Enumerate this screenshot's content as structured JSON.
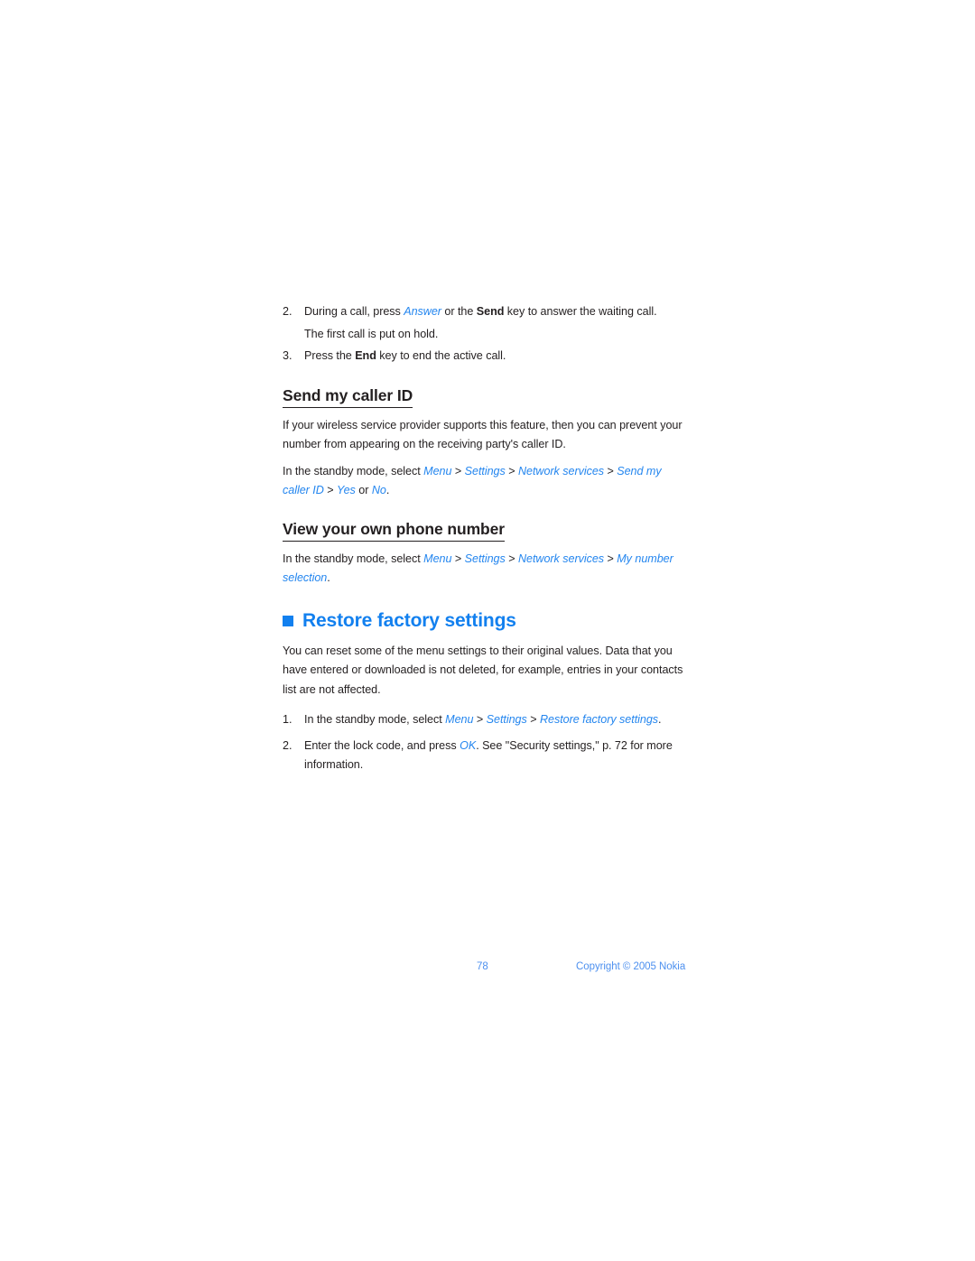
{
  "document": {
    "type": "user-guide-page",
    "page_number": "78",
    "copyright": "Copyright © 2005 Nokia",
    "background_color": "#ffffff",
    "body_text_color": "#231f20",
    "accent_blue": "#1280ef",
    "link_blue": "#2486ef",
    "footer_blue": "#4d90ef"
  },
  "continued_list": {
    "items": [
      {
        "num": "2.",
        "line1_pre": "During a call, press ",
        "line1_italic": "Answer",
        "line1_mid": " or the ",
        "line1_bold": "Send",
        "line1_post": " key to answer the waiting call.",
        "line2": "The first call is put on hold."
      },
      {
        "num": "3.",
        "pre": "Press the ",
        "bold": "End",
        "post": " key to end the active call."
      }
    ]
  },
  "sections": {
    "send_caller_id": {
      "heading": "Send my caller ID",
      "paragraph": "If your wireless service provider supports this feature, then you can prevent your number from appearing on the receiving party's caller ID.",
      "path_intro": "In the standby mode, select ",
      "path": [
        "Menu",
        "Settings",
        "Network services",
        "Send my caller ID",
        "Yes"
      ],
      "path_or": " or ",
      "path_last": "No",
      "path_end": "."
    },
    "view_own_number": {
      "heading": "View your own phone number",
      "path_intro": "In the standby mode, select ",
      "path": [
        "Menu",
        "Settings",
        "Network services",
        "My number selection"
      ],
      "path_end": "."
    },
    "restore_factory": {
      "heading": "Restore factory settings",
      "bullet_icon": "blue-square-bullet",
      "paragraph": "You can reset some of the menu settings to their original values. Data that you have entered or downloaded is not deleted, for example, entries in your contacts list are not affected.",
      "steps": [
        {
          "num": "1.",
          "pre": "In the standby mode, select ",
          "path": [
            "Menu",
            "Settings",
            "Restore factory settings"
          ],
          "post": "."
        },
        {
          "num": "2.",
          "pre": "Enter the lock code, and press ",
          "italic": "OK",
          "post": ". See \"Security settings,\" p. 72 for more information."
        }
      ]
    }
  },
  "separator": " > "
}
